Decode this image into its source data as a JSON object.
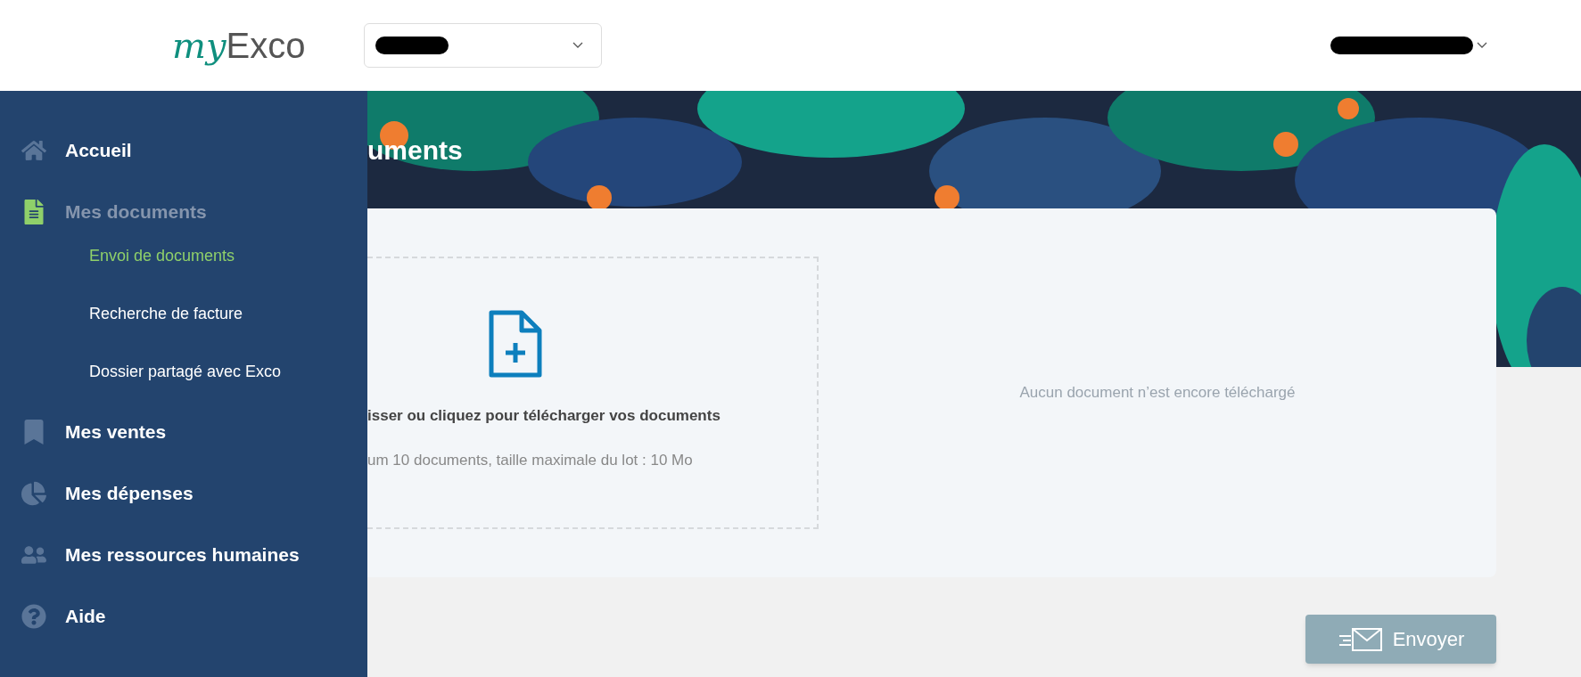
{
  "header": {
    "logo": {
      "script_part": "my",
      "plain_part": "Exco"
    }
  },
  "sidebar": {
    "items": [
      {
        "label": "Accueil",
        "selected": false,
        "expanded": false
      },
      {
        "label": "Mes documents",
        "selected": true,
        "expanded": true,
        "children": [
          {
            "label": "Envoi de documents",
            "selected": true
          },
          {
            "label": "Recherche de facture",
            "selected": false
          },
          {
            "label": "Dossier partagé avec Exco",
            "selected": false
          }
        ]
      },
      {
        "label": "Mes ventes",
        "selected": false,
        "expanded": false
      },
      {
        "label": "Mes dépenses",
        "selected": false,
        "expanded": false
      },
      {
        "label": "Mes ressources humaines",
        "selected": false,
        "expanded": false
      },
      {
        "label": "Aide",
        "selected": false,
        "expanded": false
      }
    ]
  },
  "page": {
    "title": "uments",
    "dropzone": {
      "instruction": "isser ou cliquez pour télécharger vos documents",
      "limits": "um 10 documents, taille maximale du lot : 10 Mo"
    },
    "empty_message": "Aucun document n’est encore téléchargé",
    "send_button": {
      "label": "Envoyer",
      "disabled": true
    }
  }
}
